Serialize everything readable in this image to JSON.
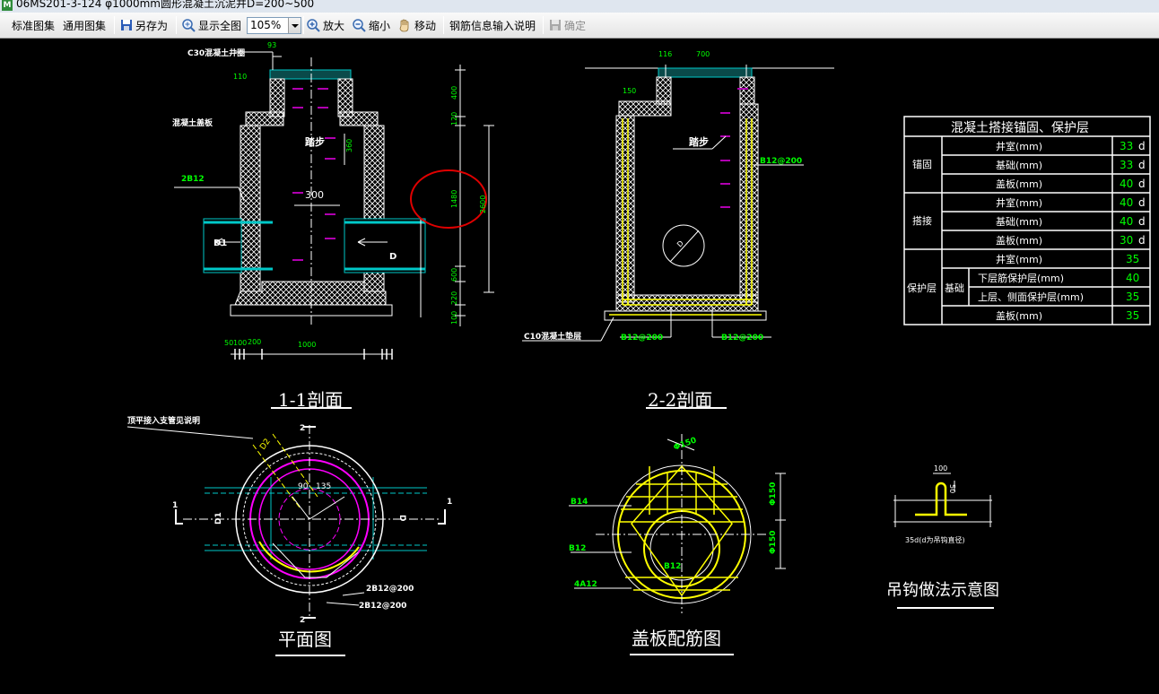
{
  "window": {
    "title": "06MS201-3-124 φ1000mm圆形混凝土沉泥井D=200~500",
    "icon_letter": "M"
  },
  "toolbar": {
    "std_atlas": "标准图集",
    "common_atlas": "通用图集",
    "save_as": "另存为",
    "fit_all": "显示全图",
    "zoom_value": "105%",
    "zoom_in": "放大",
    "zoom_out": "缩小",
    "move": "移动",
    "rebar_help": "钢筋信息输入说明",
    "confirm": "确定"
  },
  "drawing": {
    "sec11": {
      "title": "1-1剖面",
      "lbl_ring": "C30混凝土井圈",
      "lbl_cover": "混凝土盖板",
      "lbl_bar": "2B12",
      "lbl_step": "踏步",
      "d93": "93",
      "d110": "110",
      "d300": "300",
      "d360": "360",
      "d400": "400",
      "d120": "120",
      "d1480": "1480",
      "d2600": "2600",
      "d600": "600",
      "d220": "220",
      "d100": "100",
      "d50": "50",
      "d100b": "100",
      "d200": "200",
      "d1000": "1000",
      "pipe_d1": "D1",
      "pipe_d": "D"
    },
    "sec22": {
      "title": "2-2剖面",
      "d116": "116",
      "d700": "700",
      "d150": "150",
      "lbl_step": "踏步",
      "lbl_b12_right": "B12@200",
      "lbl_pad": "C10混凝土垫层",
      "lbl_b12_left": "B12@200",
      "lbl_b12_bottom": "B12@200",
      "pipe_d": "D"
    },
    "table": {
      "title": "混凝土搭接锚固、保护层",
      "groups": [
        "锚固",
        "搭接",
        "保护层"
      ],
      "sub_group": "基础",
      "rows": [
        {
          "item": "井室(mm)",
          "value": "33",
          "unit": "d"
        },
        {
          "item": "基础(mm)",
          "value": "33",
          "unit": "d"
        },
        {
          "item": "盖板(mm)",
          "value": "40",
          "unit": "d"
        },
        {
          "item": "井室(mm)",
          "value": "40",
          "unit": "d"
        },
        {
          "item": "基础(mm)",
          "value": "40",
          "unit": "d"
        },
        {
          "item": "盖板(mm)",
          "value": "30",
          "unit": "d"
        },
        {
          "item": "井室(mm)",
          "value": "35",
          "unit": ""
        },
        {
          "item": "下层筋保护层(mm)",
          "value": "40",
          "unit": ""
        },
        {
          "item": "上层、侧面保护层(mm)",
          "value": "35",
          "unit": ""
        },
        {
          "item": "盖板(mm)",
          "value": "35",
          "unit": ""
        }
      ]
    },
    "plan": {
      "title": "平面图",
      "lbl_top": "顶平接入支管见说明",
      "sec2_top": "2",
      "sec2_bottom": "2",
      "sec1_left": "1",
      "sec1_right": "1",
      "d2": "D2",
      "a90": "90",
      "a135": "135",
      "pipe_d1": "D1",
      "pipe_d": "D",
      "lbl_b12_a": "2B12@200",
      "lbl_b12_b": "2B12@200"
    },
    "cover": {
      "title": "盖板配筋图",
      "phi150_top": "Φ150",
      "lbl_b14": "B14",
      "lbl_b12_left": "B12",
      "lbl_b12_center": "B12",
      "lbl_4a12": "4A12",
      "phi150_r1": "Φ150",
      "phi150_r2": "Φ150"
    },
    "hook": {
      "title": "吊钩做法示意图",
      "d100": "100",
      "d50": "50",
      "note": "35d(d为吊钩直径)"
    }
  },
  "colors": {
    "background": "#000000",
    "line": "#ffffff",
    "dimension_green": "#00ff00",
    "rebar_yellow": "#ffff00",
    "pipe_cyan": "#00c8c8",
    "magenta": "#ff00ff",
    "annotation_red": "#ff0000"
  }
}
